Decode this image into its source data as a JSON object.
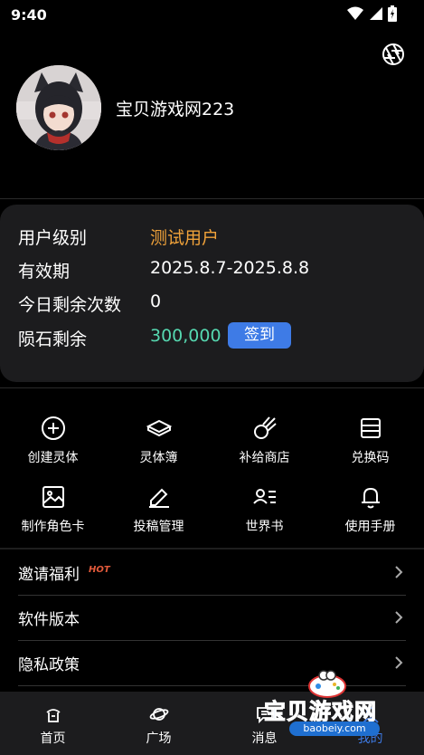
{
  "status_bar": {
    "time": "9:40"
  },
  "profile": {
    "username": "宝贝游戏网223"
  },
  "info_card": {
    "rows": [
      {
        "label": "用户级别",
        "value": "测试用户"
      },
      {
        "label": "有效期",
        "value": "2025.8.7-2025.8.8"
      },
      {
        "label": "今日剩余次数",
        "value": "0"
      },
      {
        "label": "陨石剩余",
        "value": "300,000"
      }
    ],
    "checkin_label": "签到"
  },
  "grid": [
    {
      "label": "创建灵体",
      "icon": "plus-circle-icon"
    },
    {
      "label": "灵体簿",
      "icon": "book-icon"
    },
    {
      "label": "补给商店",
      "icon": "meteor-icon"
    },
    {
      "label": "兑换码",
      "icon": "redeem-code-icon"
    },
    {
      "label": "制作角色卡",
      "icon": "image-icon"
    },
    {
      "label": "投稿管理",
      "icon": "edit-icon"
    },
    {
      "label": "世界书",
      "icon": "person-list-icon"
    },
    {
      "label": "使用手册",
      "icon": "bell-icon"
    }
  ],
  "list": [
    {
      "label": "邀请福利",
      "badge": "HOT"
    },
    {
      "label": "软件版本"
    },
    {
      "label": "隐私政策"
    }
  ],
  "bottom_nav": [
    {
      "label": "首页",
      "icon": "home-icon"
    },
    {
      "label": "广场",
      "icon": "planet-icon"
    },
    {
      "label": "消息",
      "icon": "message-icon"
    },
    {
      "label": "我的",
      "icon": "profile-icon"
    }
  ],
  "watermark": {
    "text": "宝贝游戏网",
    "url": "baobeiy.com"
  },
  "colors": {
    "accent_blue": "#3e7be6",
    "level_orange": "#f0a23a",
    "balance_green": "#56d8b0",
    "card_bg": "#1c1c1e"
  }
}
